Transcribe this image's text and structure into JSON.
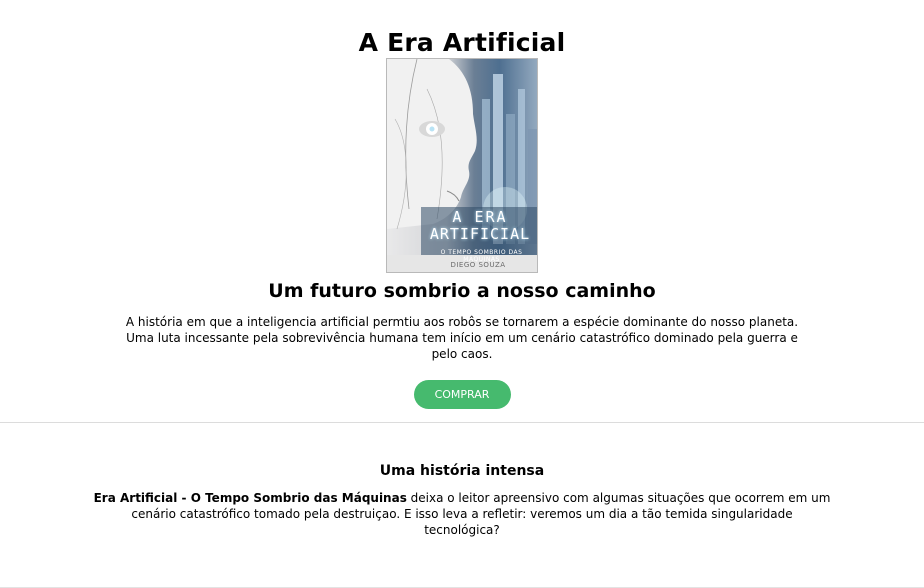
{
  "hero": {
    "title": "A Era Artificial",
    "cover": {
      "title_line1": "A ERA",
      "title_line2": "ARTIFICIAL",
      "subtitle": "O TEMPO SOMBRIO DAS MÁQUINAS",
      "author": "DIEGO SOUZA"
    },
    "subtitle": "Um futuro sombrio a nosso caminho",
    "description": "A história em que a inteligencia artificial permtiu aos robôs se tornarem a espécie dominante do nosso planeta. Uma luta incessante pela sobrevivência humana tem início em um cenário catastrófico dominado pela guerra e pelo caos.",
    "buy_label": "COMPRAR",
    "buy_color": "#46ba6e"
  },
  "section": {
    "heading": "Uma história intensa",
    "body_bold": "Era Artificial - O Tempo Sombrio das Máquinas",
    "body_rest": " deixa o leitor apreensivo com algumas situações que ocorrem em um cenário catastrófico tomado pela destruiçao. E isso leva a refletir: veremos um dia a tão temida singularidade tecnológica?"
  }
}
